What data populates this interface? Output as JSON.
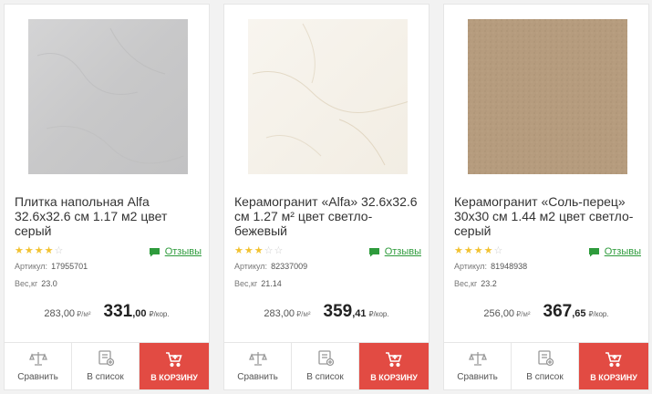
{
  "products": [
    {
      "title": "Плитка напольная Alfa 32.6х32.6 см 1.17 м2 цвет серый",
      "image": "grey-marble-tile",
      "tile_color": "#cbcbcc",
      "rating": 4,
      "stars": [
        "★",
        "★",
        "★",
        "★",
        "☆"
      ],
      "reviews_label": "Отзывы",
      "article_label": "Артикул:",
      "article": "17955701",
      "weight_label": "Вес,кг",
      "weight": "23.0",
      "unit_price": "283,00",
      "unit_price_unit": "₽/м²",
      "box_price_main": "331",
      "box_price_cents": ",00",
      "box_price_unit": "₽/кор.",
      "compare_label": "Сравнить",
      "list_label": "В список",
      "cart_label": "В корзину"
    },
    {
      "title": "Керамогранит «Alfa» 32.6х32.6 см 1.27 м² цвет светло-бежевый",
      "image": "beige-marble-tile",
      "tile_color": "#f6f2ea",
      "rating": 3,
      "stars": [
        "★",
        "★",
        "★",
        "☆",
        "☆"
      ],
      "reviews_label": "Отзывы",
      "article_label": "Артикул:",
      "article": "82337009",
      "weight_label": "Вес,кг",
      "weight": "21.14",
      "unit_price": "283,00",
      "unit_price_unit": "₽/м²",
      "box_price_main": "359",
      "box_price_cents": ",41",
      "box_price_unit": "₽/кор.",
      "compare_label": "Сравнить",
      "list_label": "В список",
      "cart_label": "В корзину"
    },
    {
      "title": "Керамогранит «Соль-перец» 30х30 см 1.44 м2 цвет светло-серый",
      "image": "salt-pepper-tile",
      "tile_color": "#b69c7e",
      "rating": 4,
      "stars": [
        "★",
        "★",
        "★",
        "★",
        "☆"
      ],
      "reviews_label": "Отзывы",
      "article_label": "Артикул:",
      "article": "81948938",
      "weight_label": "Вес,кг",
      "weight": "23.2",
      "unit_price": "256,00",
      "unit_price_unit": "₽/м²",
      "box_price_main": "367",
      "box_price_cents": ",65",
      "box_price_unit": "₽/кор.",
      "compare_label": "Сравнить",
      "list_label": "В список",
      "cart_label": "В корзину"
    }
  ],
  "colors": {
    "cart_button": "#e24b43",
    "reviews_link": "#2e9b3c",
    "star_filled": "#f2c230",
    "star_empty": "#cccccc"
  }
}
